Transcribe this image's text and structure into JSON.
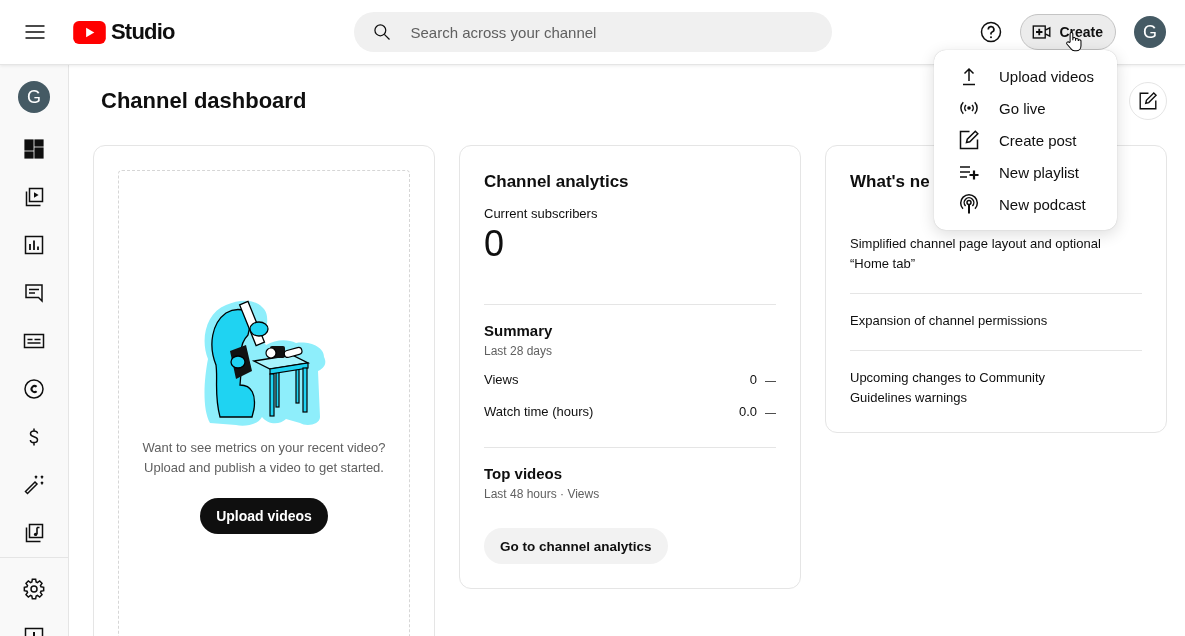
{
  "topbar": {
    "logo_text": "Studio",
    "search": {
      "placeholder": "Search across your channel"
    },
    "create_button": {
      "label": "Create",
      "expanded": true
    },
    "account_avatar": "G"
  },
  "create_menu": {
    "items": [
      {
        "kind": "upload",
        "label": "Upload videos"
      },
      {
        "kind": "live",
        "label": "Go live"
      },
      {
        "kind": "post",
        "label": "Create post"
      },
      {
        "kind": "playlist",
        "label": "New playlist"
      },
      {
        "kind": "podcast",
        "label": "New podcast"
      }
    ]
  },
  "sidebar": {
    "channel_avatar": "G",
    "items": [
      {
        "kind": "dashboard",
        "selected": true
      },
      {
        "kind": "content",
        "selected": false
      },
      {
        "kind": "analytics",
        "selected": false
      },
      {
        "kind": "comments",
        "selected": false
      },
      {
        "kind": "subtitles",
        "selected": false
      },
      {
        "kind": "copyright",
        "selected": false
      },
      {
        "kind": "earn",
        "selected": false
      },
      {
        "kind": "customization",
        "selected": false
      },
      {
        "kind": "audio_library",
        "selected": false
      }
    ],
    "footer_items": [
      {
        "kind": "settings",
        "selected": false
      },
      {
        "kind": "feedback",
        "selected": false
      }
    ]
  },
  "page_title": "Channel dashboard",
  "video_card": {
    "message_lines": [
      "Want to see metrics on your recent video?",
      "Upload and publish a video to get started."
    ],
    "button": "Upload videos"
  },
  "analytics_card": {
    "title": "Channel analytics",
    "subscribers_label": "Current subscribers",
    "subscribers_value": "0",
    "summary": {
      "title": "Summary",
      "period": "Last 28 days",
      "rows": [
        {
          "label": "Views",
          "value": "0",
          "change": "—"
        },
        {
          "label": "Watch time (hours)",
          "value": "0.0",
          "change": "—"
        }
      ]
    },
    "top_videos": {
      "title": "Top videos",
      "period": "Last 48 hours · Views"
    },
    "button": "Go to channel analytics"
  },
  "whats_new_card": {
    "title": "What's ne",
    "items": [
      "Simplified channel page layout and optional “Home tab”",
      "Expansion of channel permissions",
      "Upcoming changes to Community Guidelines warnings"
    ]
  }
}
